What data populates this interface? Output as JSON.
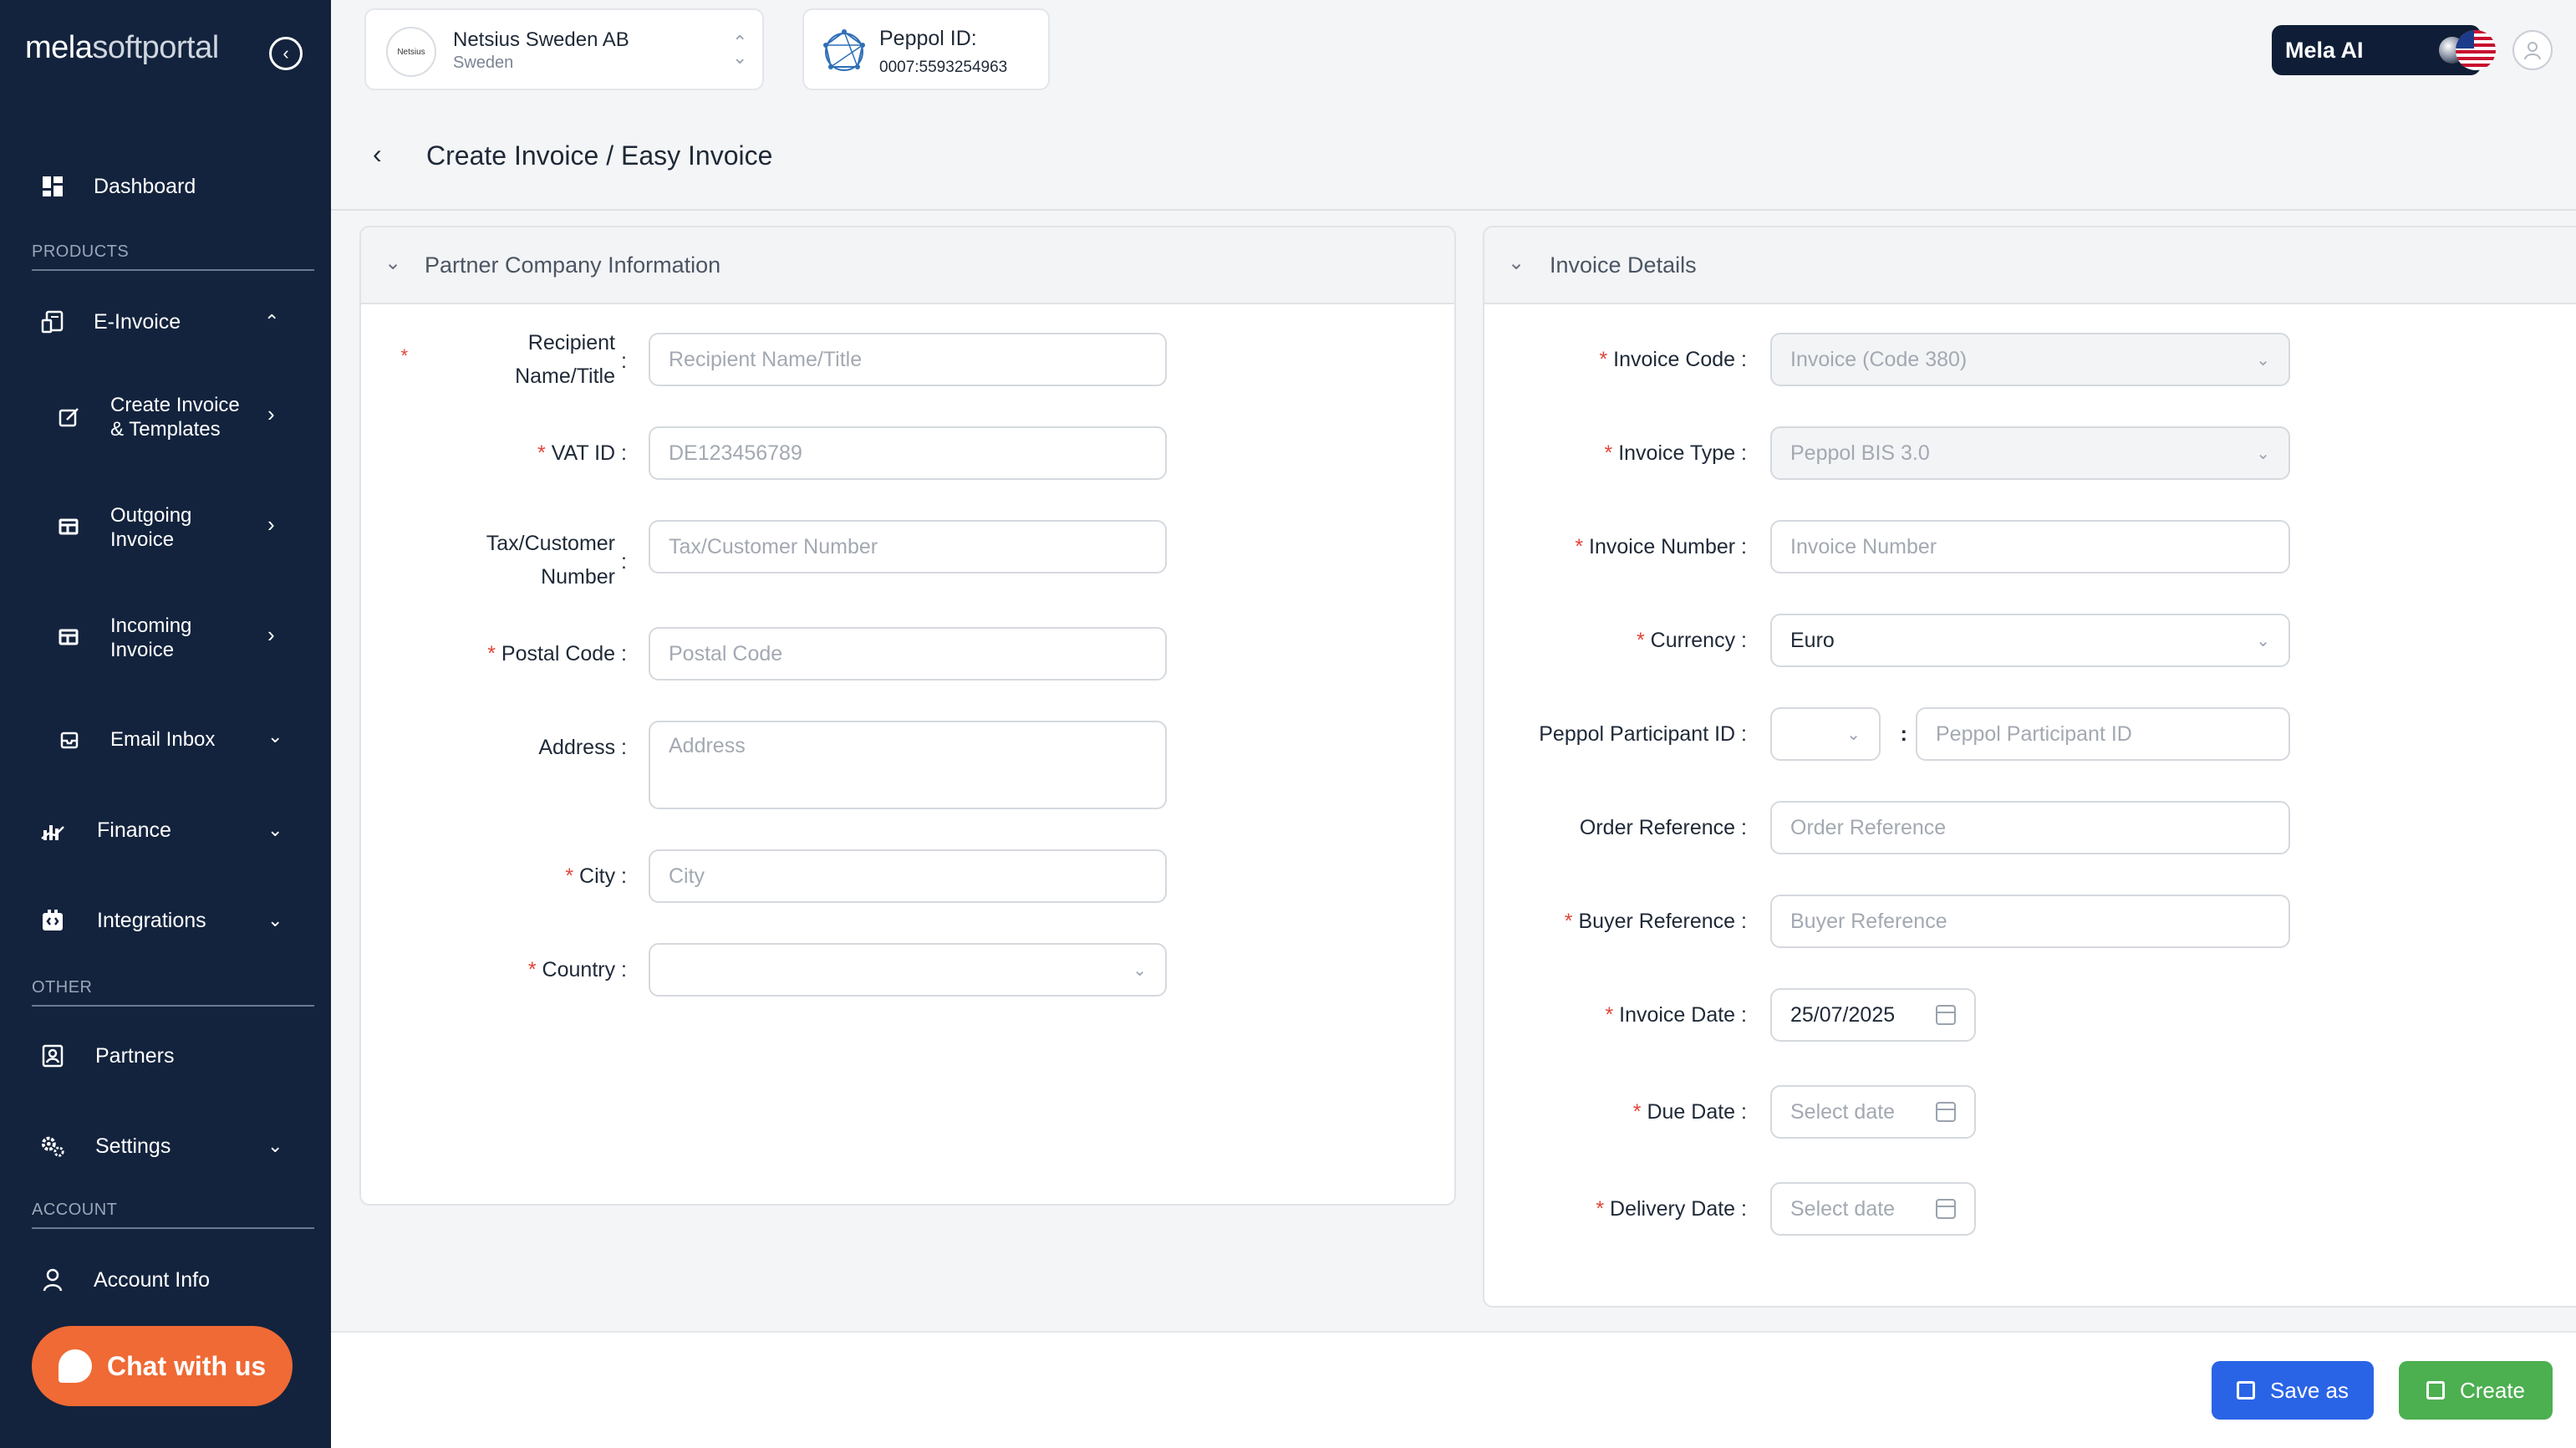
{
  "sidebar": {
    "logo_bold": "mela",
    "logo_thin": "softportal",
    "collapse_icon": "‹",
    "dashboard": "Dashboard",
    "products_label": "PRODUCTS",
    "einvoice": "E-Invoice",
    "create_invoice_line1": "Create Invoice",
    "create_invoice_line2": "& Templates",
    "outgoing_line1": "Outgoing",
    "outgoing_line2": "Invoice",
    "incoming_line1": "Incoming",
    "incoming_line2": "Invoice",
    "email_inbox": "Email Inbox",
    "finance": "Finance",
    "integrations": "Integrations",
    "other_label": "OTHER",
    "partners": "Partners",
    "settings": "Settings",
    "account_label": "ACCOUNT",
    "account_info": "Account Info",
    "chat": "Chat with us"
  },
  "topbar": {
    "company_logo_text": "Netsius",
    "company_name": "Netsius Sweden AB",
    "company_country": "Sweden",
    "peppol_title": "Peppol ID:",
    "peppol_value": "0007:5593254963",
    "mela_ai": "Mela AI",
    "page_title": "Create Invoice / Easy Invoice"
  },
  "partner_panel": {
    "title": "Partner Company Information",
    "recipient_label_1": "Recipient",
    "recipient_label_2": "Name/Title",
    "recipient_placeholder": "Recipient Name/Title",
    "vat_label": "VAT ID",
    "vat_placeholder": "DE123456789",
    "tax_label_1": "Tax/Customer",
    "tax_label_2": "Number",
    "tax_placeholder": "Tax/Customer Number",
    "postal_label": "Postal Code",
    "postal_placeholder": "Postal Code",
    "address_label": "Address",
    "address_placeholder": "Address",
    "city_label": "City",
    "city_placeholder": "City",
    "country_label": "Country",
    "country_value": ""
  },
  "invoice_panel": {
    "title": "Invoice Details",
    "code_label": "Invoice Code",
    "code_value": "Invoice (Code 380)",
    "type_label": "Invoice Type",
    "type_value": "Peppol BIS 3.0",
    "number_label": "Invoice Number",
    "number_placeholder": "Invoice Number",
    "currency_label": "Currency",
    "currency_value": "Euro",
    "peppol_label": "Peppol Participant ID",
    "peppol_scheme_value": "",
    "peppol_placeholder": "Peppol Participant ID",
    "order_label": "Order Reference",
    "order_placeholder": "Order Reference",
    "buyer_label": "Buyer Reference",
    "buyer_placeholder": "Buyer Reference",
    "date_label": "Invoice Date",
    "date_value": "25/07/2025",
    "due_label": "Due Date",
    "due_placeholder": "Select date",
    "delivery_label": "Delivery Date",
    "delivery_placeholder": "Select date"
  },
  "footer": {
    "save_as": "Save as",
    "create": "Create"
  },
  "colors": {
    "sidebar_bg": "#13233d",
    "chat_orange": "#ef6a35",
    "save_blue": "#2a64e6",
    "create_green": "#4caf50",
    "required_red": "#e0453a"
  },
  "icons": [
    "dashboard-icon",
    "einvoice-icon",
    "edit-icon",
    "outgoing-icon",
    "incoming-icon",
    "inbox-icon",
    "finance-icon",
    "integrations-icon",
    "partners-icon",
    "settings-icon",
    "user-icon",
    "chat-bubble-icon",
    "peppol-network-icon",
    "us-flag-icon",
    "avatar-icon",
    "calendar-icon",
    "chevron-down-icon",
    "save-icon",
    "create-icon"
  ]
}
